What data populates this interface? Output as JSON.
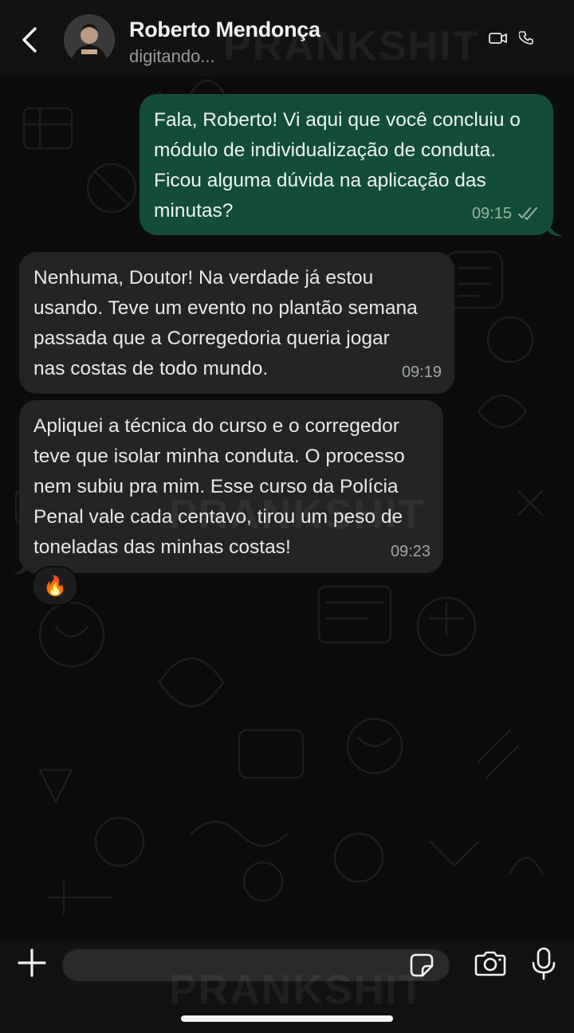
{
  "header": {
    "contact_name": "Roberto Mendonça",
    "contact_status": "digitando...",
    "back_icon": "chevron-left-icon",
    "video_icon": "video-camera-icon",
    "call_icon": "phone-icon"
  },
  "watermark": "PRANKSHIT",
  "messages": [
    {
      "direction": "outgoing",
      "text": "Fala, Roberto! Vi aqui que você concluiu o\nmódulo de individualização de conduta.\nFicou alguma dúvida na aplicação das\nminutas?",
      "time": "09:15",
      "status_icon": "double-check-icon"
    },
    {
      "direction": "incoming",
      "text": "Nenhuma, Doutor! Na verdade já estou\nusando. Teve um evento no plantão semana\npassada que a Corregedoria queria jogar\nnas costas de todo mundo.",
      "time": "09:19"
    },
    {
      "direction": "incoming",
      "text": "Apliquei a técnica do curso e o corregedor\nteve que isolar minha conduta. O processo\nnem subiu pra mim. Esse curso da Polícia\nPenal vale cada centavo, tirou um peso de\ntoneladas das minhas costas!",
      "time": "09:23",
      "reaction": "🔥"
    }
  ],
  "input_bar": {
    "placeholder": "",
    "plus_icon": "plus-icon",
    "sticker_icon": "sticker-icon",
    "camera_icon": "camera-icon",
    "mic_icon": "microphone-icon"
  },
  "colors": {
    "outgoing_bubble": "#144d37",
    "incoming_bubble": "#242424",
    "header_bg": "#121212",
    "background": "#0c0c0c"
  }
}
